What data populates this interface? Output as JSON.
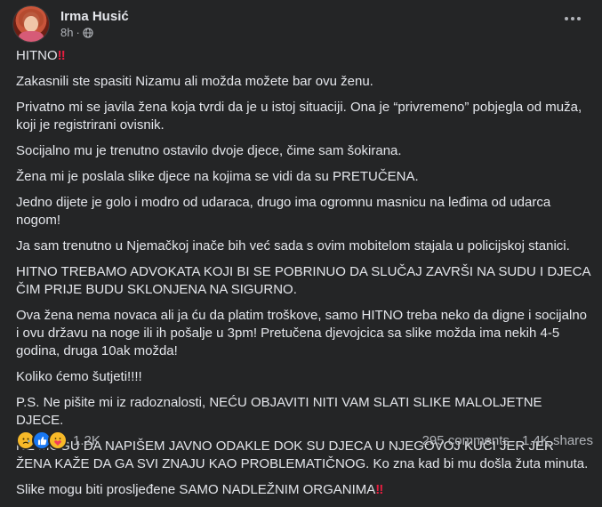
{
  "post": {
    "author": "Irma Husić",
    "time": "8h",
    "time_separator": "·",
    "privacy_icon": "globe-icon",
    "more_icon": "more-options-icon"
  },
  "body": {
    "p1": "HITNO",
    "p1_mark": "‼",
    "p2": "Zakasnili ste spasiti Nizamu ali možda možete bar ovu ženu.",
    "p3": "Privatno mi se javila žena koja tvrdi da je u istoj situaciji. Ona je “privremeno” pobjegla od muža, koji je registrirani ovisnik.",
    "p4": "Socijalno mu je trenutno ostavilo dvoje djece, čime sam šokirana.",
    "p5": "Žena mi je poslala slike djece na kojima se vidi da su PRETUČENA.",
    "p6": "Jedno dijete je golo i modro od udaraca, drugo ima ogromnu masnicu na leđima od udarca nogom!",
    "p7": "Ja sam trenutno u Njemačkoj inače bih već sada s ovim mobitelom stajala u policijskoj stanici.",
    "p8": "HITNO TREBAMO ADVOKATA KOJI BI SE POBRINUO DA SLUČAJ ZAVRŠI NA SUDU I DJECA ČIM PRIJE BUDU SKLONJENA NA SIGURNO.",
    "p9": "Ova žena nema novaca ali ja ću da platim troškove, samo HITNO treba neko da digne i socijalno i ovu državu na noge ili ih pošalje u 3pm! Pretučena djevojcica sa slike možda ima nekih 4-5 godina, druga 10ak možda!",
    "p10": "Koliko ćemo šutjeti!!!!",
    "p11": "P.S. Ne pišite mi iz radoznalosti, NEĆU OBJAVITI NITI VAM SLATI SLIKE MALOLJETNE DJECE.",
    "p12": "NE MOGU DA NAPIŠEM JAVNO ODAKLE DOK SU DJECA U NJEGOVOJ KUĆI JER JER ŽENA KAŽE DA GA SVI ZNAJU KAO PROBLEMATIČNOG. Ko zna kad bi mu došla žuta minuta.",
    "p13": "Slike mogu biti prosljeđene SAMO NADLEŽNIM ORGANIMA",
    "p13_mark": "‼"
  },
  "footer": {
    "reaction_icons": [
      "sad-reaction-icon",
      "like-reaction-icon",
      "care-reaction-icon"
    ],
    "reactions_count": "1.2K",
    "comments": "295 comments",
    "shares": "1.4K shares"
  },
  "colors": {
    "background": "#242526",
    "text": "#e4e6eb",
    "secondary_text": "#b0b3b8",
    "exclamation": "#e41e3f",
    "like_blue": "#1877f2",
    "sad_yellow": "#f7b928"
  }
}
